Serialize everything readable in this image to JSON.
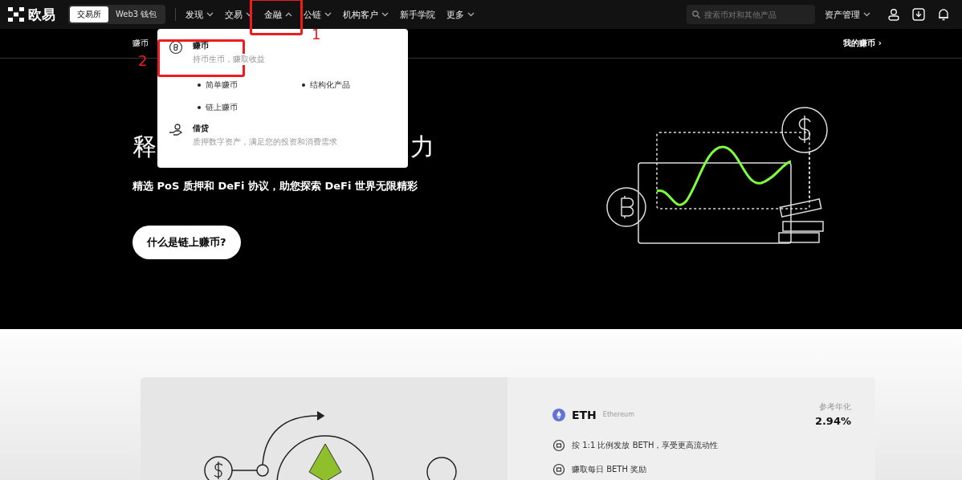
{
  "header": {
    "logo": "欧易",
    "mode_tabs": [
      {
        "label": "交易所",
        "selected": true
      },
      {
        "label": "Web3 钱包",
        "selected": false
      }
    ],
    "nav": [
      {
        "label": "发现",
        "has_menu": true,
        "expanded": false
      },
      {
        "label": "交易",
        "has_menu": true,
        "expanded": false
      },
      {
        "label": "金融",
        "has_menu": true,
        "expanded": true
      },
      {
        "label": "公链",
        "has_menu": true,
        "expanded": false
      },
      {
        "label": "机构客户",
        "has_menu": true,
        "expanded": false
      },
      {
        "label": "新手学院",
        "has_menu": false
      },
      {
        "label": "更多",
        "has_menu": true,
        "expanded": false
      }
    ],
    "search": {
      "placeholder": "搜索币对和其他产品"
    },
    "assets_menu": "资产管理"
  },
  "subnav": {
    "left": "赚币",
    "right": "我的赚币 ›"
  },
  "dropdown": {
    "sections": [
      {
        "kind": "coin",
        "title": "赚币",
        "description": "持币生币，赚取收益",
        "links": [
          "简单赚币",
          "结构化产品",
          "链上赚币"
        ]
      },
      {
        "kind": "loan",
        "title": "借贷",
        "description": "质押数字资产，满足您的投资和消费需求"
      }
    ]
  },
  "hero": {
    "title_start": "释",
    "title_end": "力",
    "subtitle": "精选 PoS 质押和 DeFi 协议，助您探索 DeFi 世界无限精彩",
    "button": "什么是链上赚币?"
  },
  "product": {
    "symbol": "ETH",
    "name": "Ethereum",
    "rate_label": "参考年化",
    "rate": "2.94%",
    "features": [
      "按 1:1 比例发放 BETH，享受更高流动性",
      "赚取每日 BETH 奖励"
    ]
  },
  "annotations": [
    "1",
    "2"
  ]
}
